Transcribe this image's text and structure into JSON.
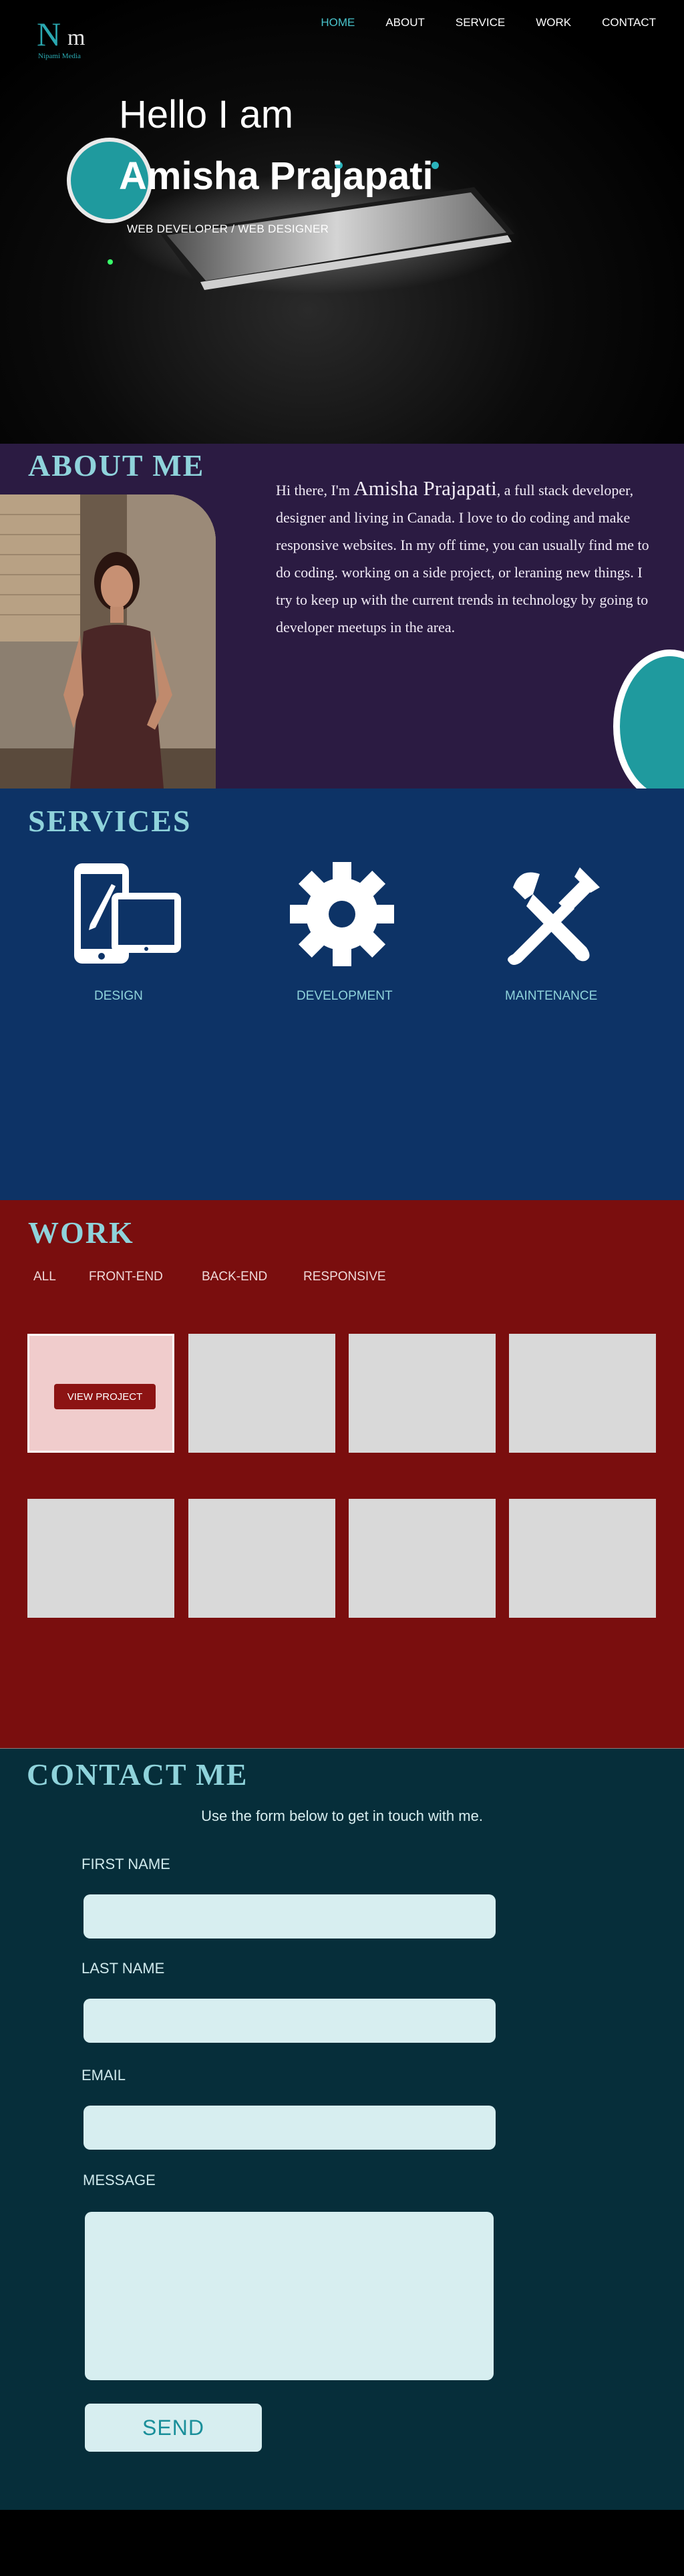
{
  "brand": {
    "logo_n": "N",
    "logo_m": "m",
    "logo_sub": "Nipami Media"
  },
  "nav": {
    "items": [
      {
        "label": "HOME",
        "active": true
      },
      {
        "label": "ABOUT",
        "active": false
      },
      {
        "label": "SERVICE",
        "active": false
      },
      {
        "label": "WORK",
        "active": false
      },
      {
        "label": "CONTACT",
        "active": false
      }
    ]
  },
  "hero": {
    "greeting": "Hello I am",
    "name": "Amisha Prajapati",
    "role": "WEB DEVELOPER / WEB DESIGNER"
  },
  "about": {
    "title": "ABOUT ME",
    "intro_before": "Hi there, I'm ",
    "intro_name": "Amisha Prajapati",
    "intro_after": ", a  full stack  developer, designer and living in Canada. I love to do coding and make responsive websites. In my off time, you can usually find me to do coding. working on a side project, or leraning new things. I try to keep up with the current trends in technology by going to developer meetups in the area."
  },
  "services": {
    "title": "SERVICES",
    "items": [
      {
        "label": "DESIGN",
        "icon": "devices-icon"
      },
      {
        "label": "DEVELOPMENT",
        "icon": "gear-icon"
      },
      {
        "label": "MAINTENANCE",
        "icon": "tools-icon"
      }
    ]
  },
  "work": {
    "title": "WORK",
    "filters": [
      "ALL",
      "FRONT-END",
      "BACK-END",
      "RESPONSIVE"
    ],
    "view_project_label": "VIEW PROJECT"
  },
  "contact": {
    "title": "CONTACT ME",
    "subtitle": "Use the form below to get in touch with me.",
    "first_name_label": "FIRST NAME",
    "last_name_label": "LAST NAME",
    "email_label": "EMAIL",
    "message_label": "MESSAGE",
    "first_name_value": "",
    "last_name_value": "",
    "email_value": "",
    "message_value": "",
    "send_label": "SEND"
  },
  "colors": {
    "accent_teal": "#2aa8b0",
    "about_bg": "#2b1b42",
    "services_bg": "#0d3366",
    "work_bg": "#7a0e0e",
    "contact_bg": "#062e3a"
  }
}
